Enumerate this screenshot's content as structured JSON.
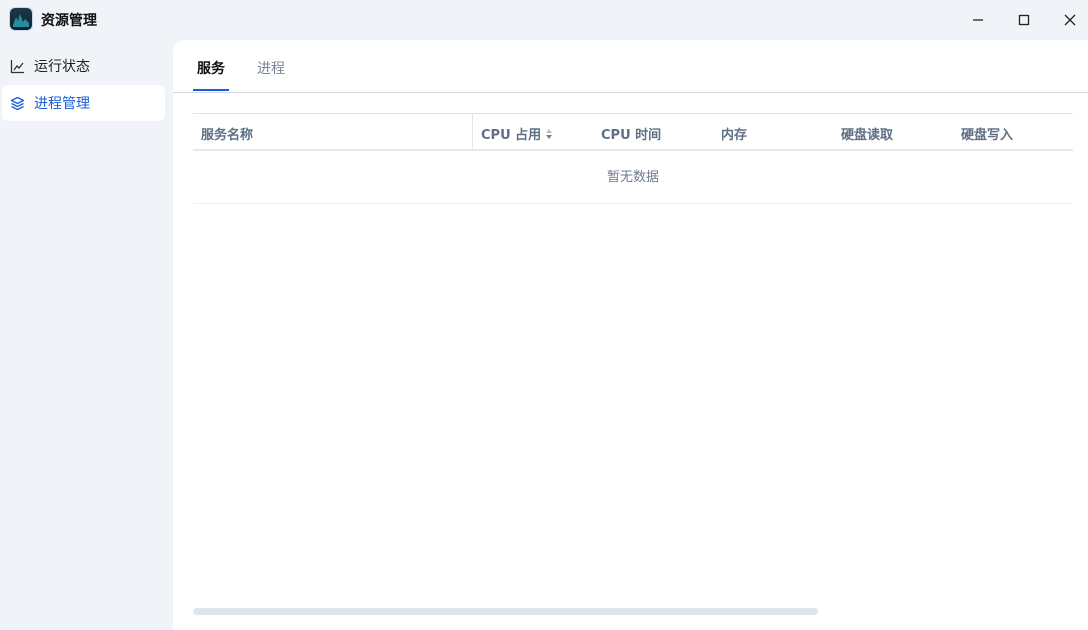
{
  "window": {
    "title": "资源管理",
    "app_icon": "activity-monitor-icon"
  },
  "sidebar": {
    "items": [
      {
        "label": "运行状态",
        "icon": "line-chart-icon"
      },
      {
        "label": "进程管理",
        "icon": "layers-icon",
        "active": true
      }
    ]
  },
  "tabs": [
    {
      "label": "服务",
      "active": true
    },
    {
      "label": "进程"
    }
  ],
  "table": {
    "columns": [
      "服务名称",
      "CPU 占用",
      "CPU 时间",
      "内存",
      "硬盘读取",
      "硬盘写入"
    ],
    "empty_text": "暂无数据",
    "sort_icon": "sort-icon"
  },
  "colors": {
    "accent": "#1a5fd6",
    "background": "#f0f3f8"
  }
}
